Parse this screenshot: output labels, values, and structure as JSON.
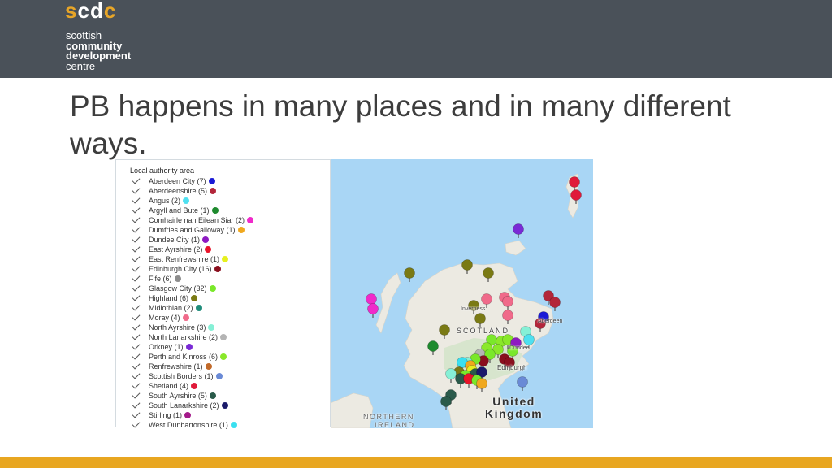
{
  "header": {
    "logo_letters": [
      "s",
      "c",
      "d",
      "c"
    ],
    "org_line1": "scottish",
    "org_line2": "community",
    "org_line3": "development",
    "org_line4": "centre",
    "background_color": "#4a5159",
    "accent_color": "#e8a628"
  },
  "slide": {
    "title_line1": "PB happens in many places and in many different",
    "title_line2": "ways."
  },
  "legend": {
    "title": "Local authority area",
    "items": [
      {
        "label": "Aberdeen City (7)",
        "color": "#1a1ad6"
      },
      {
        "label": "Aberdeenshire (5)",
        "color": "#b3263a"
      },
      {
        "label": "Angus (2)",
        "color": "#4fe0f0"
      },
      {
        "label": "Argyll and Bute (1)",
        "color": "#1e8a2e"
      },
      {
        "label": "Comhairle nan Eilean Siar (2)",
        "color": "#f02aca"
      },
      {
        "label": "Dumfries and Galloway (1)",
        "color": "#f0a81e"
      },
      {
        "label": "Dundee City (1)",
        "color": "#8e1ac2"
      },
      {
        "label": "East Ayrshire (2)",
        "color": "#e8142a"
      },
      {
        "label": "East Renfrewshire (1)",
        "color": "#e6f01e"
      },
      {
        "label": "Edinburgh City (16)",
        "color": "#8a0f1e"
      },
      {
        "label": "Fife (6)",
        "color": "#8c8c8c"
      },
      {
        "label": "Glasgow City (32)",
        "color": "#7ae82a"
      },
      {
        "label": "Highland (6)",
        "color": "#7a7a14"
      },
      {
        "label": "Midlothian (2)",
        "color": "#1e8c7a"
      },
      {
        "label": "Moray (4)",
        "color": "#f06a8a"
      },
      {
        "label": "North Ayrshire (3)",
        "color": "#86f0d6"
      },
      {
        "label": "North Lanarkshire (2)",
        "color": "#b4b4b4"
      },
      {
        "label": "Orkney (1)",
        "color": "#7a2ad6"
      },
      {
        "label": "Perth and Kinross (6)",
        "color": "#8ae82a"
      },
      {
        "label": "Renfrewshire (1)",
        "color": "#c26a2a"
      },
      {
        "label": "Scottish Borders (1)",
        "color": "#6a8ad6"
      },
      {
        "label": "Shetland (4)",
        "color": "#e01a3a"
      },
      {
        "label": "South Ayrshire (5)",
        "color": "#2a5a4a"
      },
      {
        "label": "South Lanarkshire (2)",
        "color": "#1a1a6a"
      },
      {
        "label": "Stirling (1)",
        "color": "#a41a8a"
      },
      {
        "label": "West Dunbartonshire (1)",
        "color": "#3ae0f0"
      }
    ]
  },
  "map": {
    "labels": {
      "scotland": "SCOTLAND",
      "inverness": "Inverness",
      "aberdeen": "Aberdeen",
      "dundee": "Dundee",
      "edinburgh": "Edinburgh",
      "uk_line1": "United",
      "uk_line2": "Kingdom",
      "ni_line1": "NORTHERN",
      "ni_line2": "IRELAND"
    },
    "sea_color": "#a9d6f5",
    "land_color": "#eceae2"
  },
  "footer": {
    "bar_color": "#e8a620"
  }
}
